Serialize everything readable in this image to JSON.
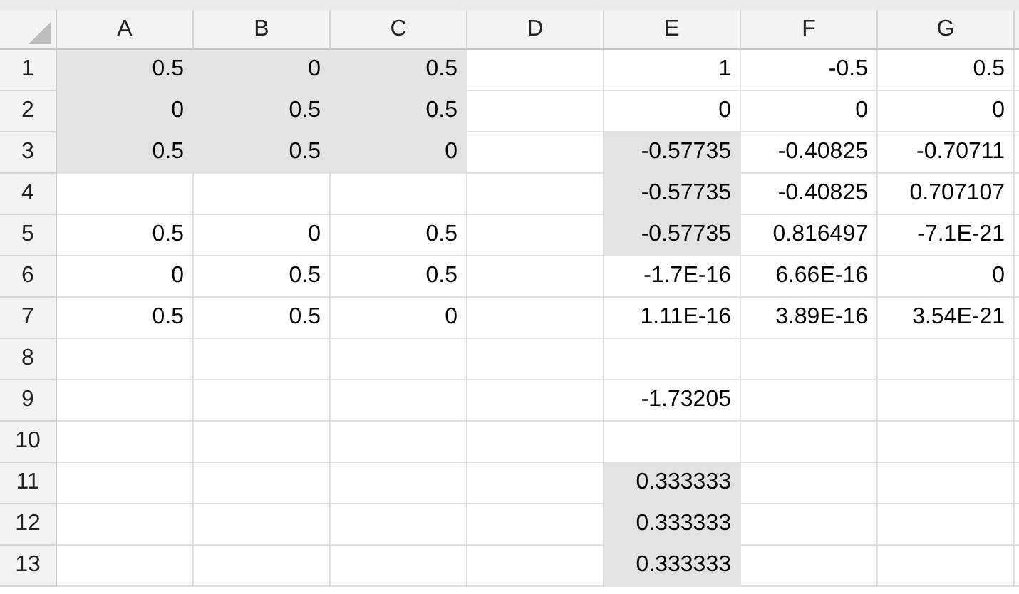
{
  "columns": [
    "A",
    "B",
    "C",
    "D",
    "E",
    "F",
    "G"
  ],
  "rows": [
    {
      "header": "1",
      "cells": [
        {
          "text": "0.5",
          "selected": true
        },
        {
          "text": "0",
          "selected": true
        },
        {
          "text": "0.5",
          "selected": true
        },
        {
          "selected": false
        },
        {
          "text": "1",
          "selected": false
        },
        {
          "text": "-0.5",
          "selected": false
        },
        {
          "text": "0.5",
          "selected": false
        }
      ]
    },
    {
      "header": "2",
      "cells": [
        {
          "text": "0",
          "selected": true
        },
        {
          "text": "0.5",
          "selected": true
        },
        {
          "text": "0.5",
          "selected": true
        },
        {
          "selected": false
        },
        {
          "text": "0",
          "selected": false
        },
        {
          "text": "0",
          "selected": false
        },
        {
          "text": "0",
          "selected": false
        }
      ]
    },
    {
      "header": "3",
      "cells": [
        {
          "text": "0.5",
          "selected": true
        },
        {
          "text": "0.5",
          "selected": true
        },
        {
          "text": "0",
          "selected": true
        },
        {
          "selected": false
        },
        {
          "text": "-0.57735",
          "selected": true
        },
        {
          "text": "-0.40825",
          "selected": false
        },
        {
          "text": "-0.70711",
          "selected": false
        }
      ]
    },
    {
      "header": "4",
      "cells": [
        {
          "selected": false
        },
        {
          "selected": false
        },
        {
          "selected": false
        },
        {
          "selected": false
        },
        {
          "text": "-0.57735",
          "selected": true
        },
        {
          "text": "-0.40825",
          "selected": false
        },
        {
          "text": "0.707107",
          "selected": false
        }
      ]
    },
    {
      "header": "5",
      "cells": [
        {
          "text": "0.5",
          "selected": false
        },
        {
          "text": "0",
          "selected": false
        },
        {
          "text": "0.5",
          "selected": false
        },
        {
          "selected": false
        },
        {
          "text": "-0.57735",
          "selected": true
        },
        {
          "text": "0.816497",
          "selected": false
        },
        {
          "text": "-7.1E-21",
          "selected": false
        }
      ]
    },
    {
      "header": "6",
      "cells": [
        {
          "text": "0",
          "selected": false
        },
        {
          "text": "0.5",
          "selected": false
        },
        {
          "text": "0.5",
          "selected": false
        },
        {
          "selected": false
        },
        {
          "text": "-1.7E-16",
          "selected": false
        },
        {
          "text": "6.66E-16",
          "selected": false
        },
        {
          "text": "0",
          "selected": false
        }
      ]
    },
    {
      "header": "7",
      "cells": [
        {
          "text": "0.5",
          "selected": false
        },
        {
          "text": "0.5",
          "selected": false
        },
        {
          "text": "0",
          "selected": false
        },
        {
          "selected": false
        },
        {
          "text": "1.11E-16",
          "selected": false
        },
        {
          "text": "3.89E-16",
          "selected": false
        },
        {
          "text": "3.54E-21",
          "selected": false
        }
      ]
    },
    {
      "header": "8",
      "cells": [
        {
          "selected": false
        },
        {
          "selected": false
        },
        {
          "selected": false
        },
        {
          "selected": false
        },
        {
          "selected": false
        },
        {
          "selected": false
        },
        {
          "selected": false
        }
      ]
    },
    {
      "header": "9",
      "cells": [
        {
          "selected": false
        },
        {
          "selected": false
        },
        {
          "selected": false
        },
        {
          "selected": false
        },
        {
          "text": "-1.73205",
          "selected": false
        },
        {
          "selected": false
        },
        {
          "selected": false
        }
      ]
    },
    {
      "header": "10",
      "cells": [
        {
          "selected": false
        },
        {
          "selected": false
        },
        {
          "selected": false
        },
        {
          "selected": false
        },
        {
          "selected": false
        },
        {
          "selected": false
        },
        {
          "selected": false
        }
      ]
    },
    {
      "header": "11",
      "cells": [
        {
          "selected": false
        },
        {
          "selected": false
        },
        {
          "selected": false
        },
        {
          "selected": false
        },
        {
          "text": "0.333333",
          "selected": true
        },
        {
          "selected": false
        },
        {
          "selected": false
        }
      ]
    },
    {
      "header": "12",
      "cells": [
        {
          "selected": false
        },
        {
          "selected": false
        },
        {
          "selected": false
        },
        {
          "selected": false
        },
        {
          "text": "0.333333",
          "selected": true
        },
        {
          "selected": false
        },
        {
          "selected": false
        }
      ]
    },
    {
      "header": "13",
      "cells": [
        {
          "selected": false
        },
        {
          "selected": false
        },
        {
          "selected": false
        },
        {
          "selected": false
        },
        {
          "text": "0.333333",
          "selected": true
        },
        {
          "selected": false
        },
        {
          "selected": false
        }
      ]
    }
  ]
}
